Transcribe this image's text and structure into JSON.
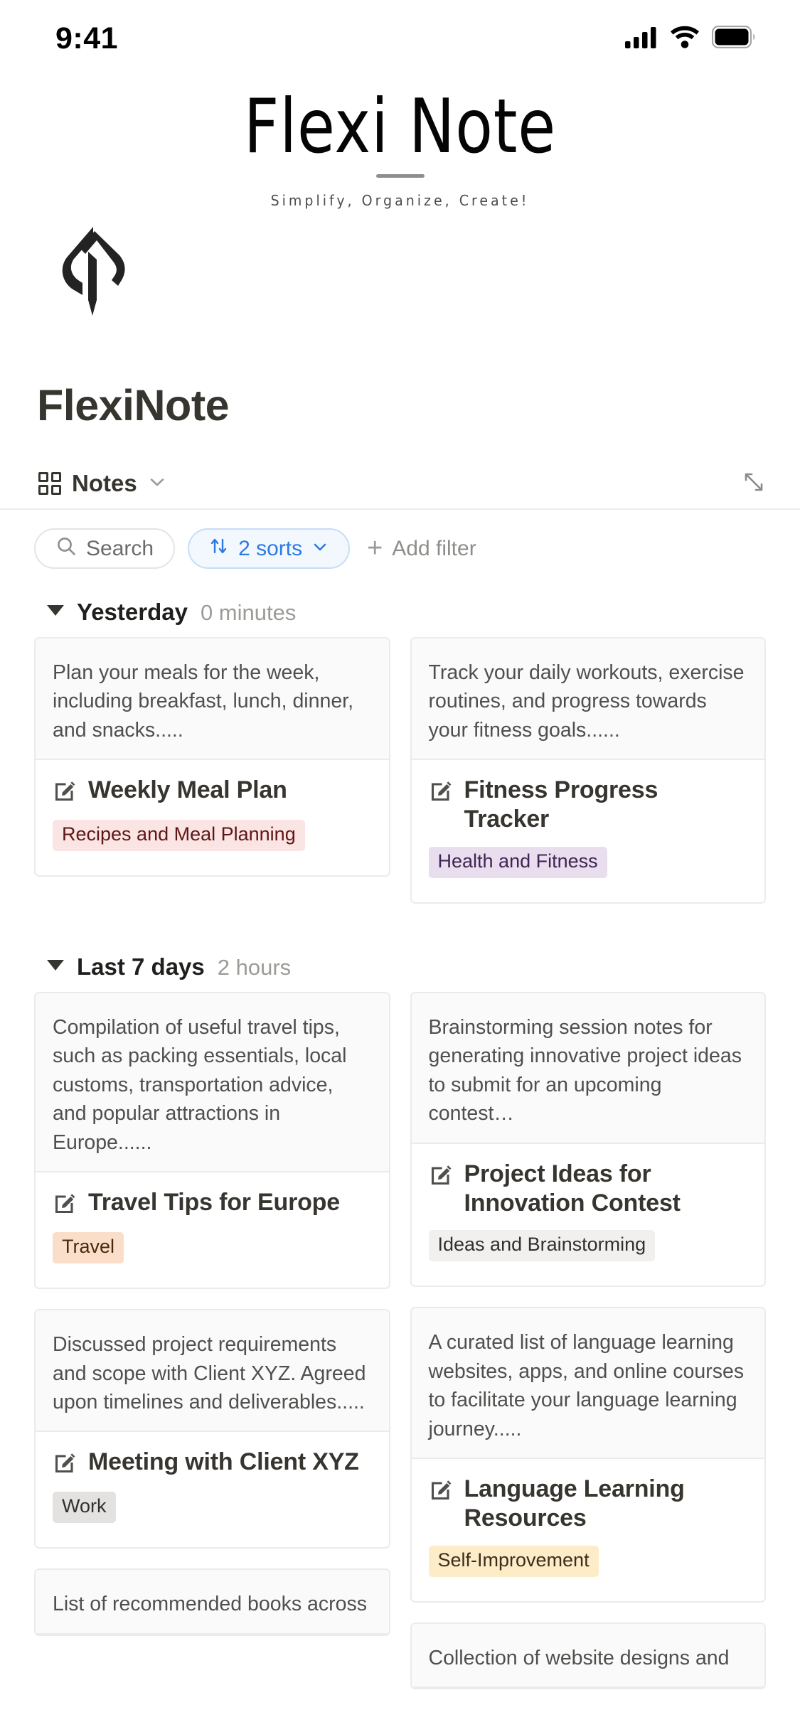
{
  "statusbar": {
    "time": "9:41",
    "icons": [
      "cellular-signal-icon",
      "wifi-icon",
      "battery-icon"
    ]
  },
  "splash": {
    "brand_title": "Flexi Note",
    "tagline": "Simplify, Organize, Create!",
    "logo": "flexinote-quill-logo"
  },
  "header": {
    "page_title": "FlexiNote",
    "view_tab": {
      "label": "Notes",
      "icon": "grid-view-icon",
      "chevron": "chevron-down-icon"
    },
    "expand": {
      "icon": "expand-diagonal-icon"
    }
  },
  "filterbar": {
    "search": {
      "label": "Search",
      "icon": "search-icon"
    },
    "sorts": {
      "label": "2 sorts",
      "icon": "sort-arrows-icon",
      "chevron": "chevron-down-icon",
      "count": 2,
      "accent": "#2b7ae4"
    },
    "add_filter": {
      "label": "Add filter",
      "icon": "plus-icon"
    }
  },
  "groups": [
    {
      "title": "Yesterday",
      "meta": "0 minutes",
      "caret": "triangle-down-icon",
      "columns": [
        [
          {
            "preview": "Plan your meals for the week, including breakfast, lunch, dinner, and snacks.....",
            "title": "Weekly Meal Plan",
            "icon": "note-edit-icon",
            "tag": {
              "label": "Recipes and Meal Planning",
              "bg": "#fbe4e4",
              "fg": "#5d1715"
            }
          }
        ],
        [
          {
            "preview": "Track your daily workouts, exercise routines, and progress towards your fitness goals......",
            "title": "Fitness Progress Tracker",
            "icon": "note-edit-icon",
            "tag": {
              "label": "Health and Fitness",
              "bg": "#e8deee",
              "fg": "#412454"
            }
          }
        ]
      ]
    },
    {
      "title": "Last 7 days",
      "meta": "2 hours",
      "caret": "triangle-down-icon",
      "columns": [
        [
          {
            "preview": "Compilation of useful travel tips, such as packing essentials, local customs, transportation advice, and popular attractions in Europe......",
            "title": "Travel Tips for Europe",
            "icon": "note-edit-icon",
            "tag": {
              "label": "Travel",
              "bg": "#fadec9",
              "fg": "#49290e"
            }
          },
          {
            "preview": "Discussed project requirements and scope with Client XYZ. Agreed upon timelines and deliverables.....",
            "title": "Meeting with Client XYZ",
            "icon": "note-edit-icon",
            "tag": {
              "label": "Work",
              "bg": "#e3e2e0",
              "fg": "#32302c"
            }
          },
          {
            "preview": "List of recommended books across",
            "title": "",
            "icon": "note-edit-icon",
            "tag": null
          }
        ],
        [
          {
            "preview": "Brainstorming session notes for generating innovative project ideas to submit for an upcoming contest…",
            "title": "Project Ideas for Innovation Contest",
            "icon": "note-edit-icon",
            "tag": {
              "label": "Ideas and Brainstorming",
              "bg": "#f1f0ef",
              "fg": "#32302c"
            }
          },
          {
            "preview": "A curated list of language learning websites, apps, and online courses to facilitate your language learning journey.....",
            "title": "Language Learning Resources",
            "icon": "note-edit-icon",
            "tag": {
              "label": "Self-Improvement",
              "bg": "#fdecc8",
              "fg": "#402c1b"
            }
          },
          {
            "preview": "Collection of website designs and",
            "title": "",
            "icon": "note-edit-icon",
            "tag": null
          }
        ]
      ]
    }
  ]
}
